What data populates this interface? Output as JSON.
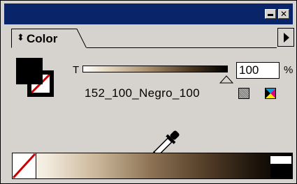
{
  "panel": {
    "tab_label": "Color",
    "tint_label": "T",
    "tint_value": "100",
    "tint_unit": "%",
    "tint_level_percent": 100,
    "swatch_name": "152_100_Negro_100"
  },
  "icons": {
    "minimize": "minimize-icon",
    "close": "close-icon",
    "close_glyph": "✕",
    "tab_arrows": "↕",
    "menu": "panel-menu-arrow-icon",
    "eyedropper": "eyedropper-icon",
    "gray_swatch": "grayscale-swatch-icon",
    "cmyk_swatch": "cmyk-swatch-icon"
  },
  "colors": {
    "titlebar": "#0a246a",
    "panel_bg": "#d6d3ce",
    "fill": "#000000",
    "none_slash": "#cc0000"
  }
}
